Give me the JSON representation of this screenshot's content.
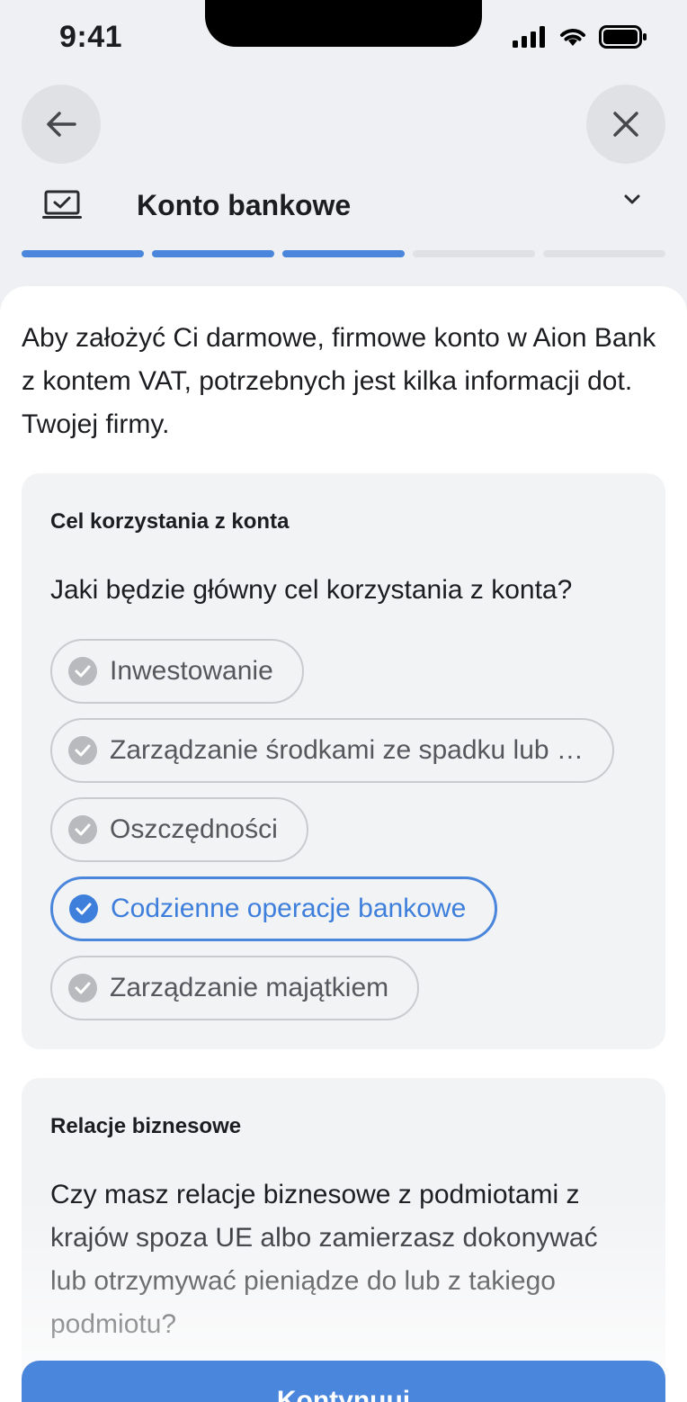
{
  "status_bar": {
    "time": "9:41"
  },
  "header": {
    "step_title": "Konto bankowe",
    "progress": {
      "total_steps": 5,
      "completed_steps": 3
    }
  },
  "intro_text": "Aby założyć Ci darmowe, firmowe konto w Aion Bank z kontem VAT, potrzebnych jest kilka informacji dot. Twojej firmy.",
  "purpose_card": {
    "title": "Cel korzystania z konta",
    "question": "Jaki będzie główny cel korzystania z konta?",
    "options": [
      {
        "label": "Inwestowanie",
        "selected": false
      },
      {
        "label": "Zarządzanie środkami ze spadku lub …",
        "selected": false
      },
      {
        "label": "Oszczędności",
        "selected": false
      },
      {
        "label": "Codzienne operacje bankowe",
        "selected": true
      },
      {
        "label": "Zarządzanie majątkiem",
        "selected": false
      }
    ]
  },
  "relations_card": {
    "title": "Relacje biznesowe",
    "question": "Czy masz relacje biznesowe z podmiotami z krajów spoza UE albo zamierzasz dokonywać lub otrzymywać pieniądze do lub z takiego podmiotu?"
  },
  "primary_button": {
    "label": "Kontynuuj"
  },
  "icons": {
    "back": "arrow-left-icon",
    "close": "close-icon",
    "step": "laptop-check-icon",
    "expand": "chevron-down-icon",
    "option_check": "check-circle-icon"
  },
  "colors": {
    "accent": "#4a86db",
    "background": "#eef0f3",
    "card": "#f2f3f5",
    "unselected_check": "#b8babe"
  }
}
